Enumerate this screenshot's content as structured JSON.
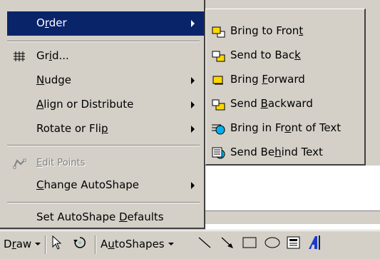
{
  "main_menu": {
    "items": [
      {
        "pre": "O",
        "acc": "r",
        "post": "der",
        "has_submenu": true,
        "selected": true
      },
      {
        "pre": "Gr",
        "acc": "i",
        "post": "d...",
        "icon": "grid-icon"
      },
      {
        "pre": "",
        "acc": "N",
        "post": "udge",
        "has_submenu": true
      },
      {
        "pre": "",
        "acc": "A",
        "post": "lign or Distribute",
        "has_submenu": true
      },
      {
        "pre": "Rotate or Fli",
        "acc": "p",
        "post": "",
        "has_submenu": true
      },
      {
        "pre": "",
        "acc": "E",
        "post": "dit Points",
        "disabled": true,
        "icon": "edit-points-icon"
      },
      {
        "pre": "",
        "acc": "C",
        "post": "hange AutoShape",
        "has_submenu": true
      },
      {
        "pre": "Set AutoShape ",
        "acc": "D",
        "post": "efaults"
      }
    ]
  },
  "order_submenu": {
    "items": [
      {
        "pre": "Bring to Fron",
        "acc": "t",
        "post": "",
        "icon": "bring-to-front-icon"
      },
      {
        "pre": "Send to Bac",
        "acc": "k",
        "post": "",
        "icon": "send-to-back-icon"
      },
      {
        "pre": "Bring ",
        "acc": "F",
        "post": "orward",
        "icon": "bring-forward-icon"
      },
      {
        "pre": "Send ",
        "acc": "B",
        "post": "ackward",
        "icon": "send-backward-icon"
      },
      {
        "pre": "Bring in Fr",
        "acc": "o",
        "post": "nt of Text",
        "icon": "bring-in-front-of-text-icon"
      },
      {
        "pre": "Send Be",
        "acc": "h",
        "post": "ind Text",
        "icon": "send-behind-text-icon"
      }
    ]
  },
  "toolbar": {
    "draw": {
      "pre": "D",
      "acc": "r",
      "post": "aw"
    },
    "autoshapes": {
      "pre": "A",
      "acc": "u",
      "post": "toShapes"
    }
  },
  "colors": {
    "selection": "#0a246a",
    "face": "#d4d0c8"
  }
}
